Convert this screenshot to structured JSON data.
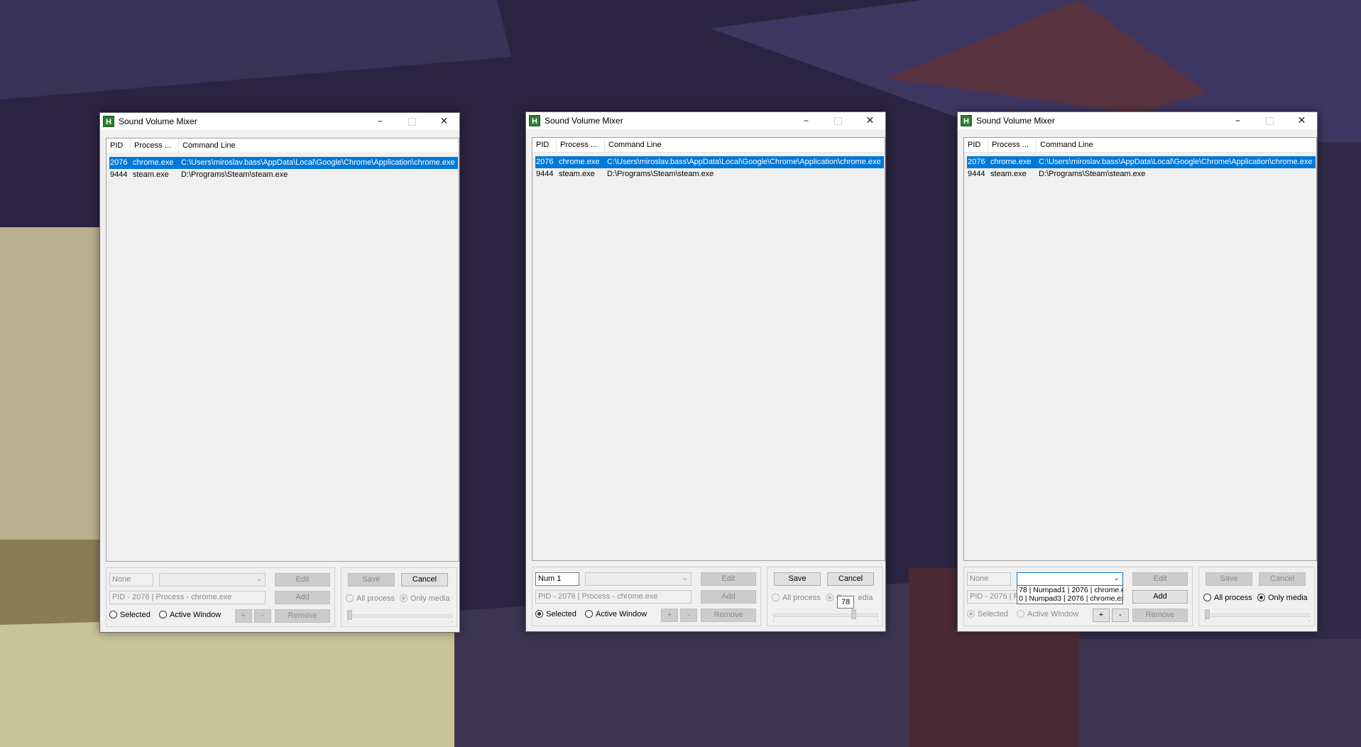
{
  "windows": [
    {
      "title": "Sound Volume Mixer",
      "controls": {
        "minimize": "–",
        "maximize": "□",
        "close": "✕"
      },
      "columns": [
        "PID",
        "Process ...",
        "Command Line"
      ],
      "rows": [
        {
          "pid": "2076",
          "process": "chrome.exe",
          "cmd": "C:\\Users\\miroslav.bass\\AppData\\Local\\Google\\Chrome\\Application\\chrome.exe",
          "selected": true
        },
        {
          "pid": "9444",
          "process": "steam.exe",
          "cmd": "D:\\Programs\\Steam\\steam.exe",
          "selected": false
        }
      ],
      "hotkey_input": "None",
      "info_text": "PID - 2076 | Process - chrome.exe",
      "edit": "Edit",
      "add": "Add",
      "remove": "Remove",
      "selected_label": "Selected",
      "active_window_label": "Active Window",
      "plus": "+",
      "minus": "-",
      "save": "Save",
      "cancel": "Cancel",
      "all_process": "All process",
      "only_media": "Only media"
    },
    {
      "title": "Sound Volume Mixer",
      "controls": {
        "minimize": "–",
        "maximize": "□",
        "close": "✕"
      },
      "columns": [
        "PID",
        "Process ...",
        "Command Line"
      ],
      "rows": [
        {
          "pid": "2076",
          "process": "chrome.exe",
          "cmd": "C:\\Users\\miroslav.bass\\AppData\\Local\\Google\\Chrome\\Application\\chrome.exe",
          "selected": true
        },
        {
          "pid": "9444",
          "process": "steam.exe",
          "cmd": "D:\\Programs\\Steam\\steam.exe",
          "selected": false
        }
      ],
      "hotkey_input": "Num 1",
      "info_text": "PID - 2076 | Process - chrome.exe",
      "edit": "Edit",
      "add": "Add",
      "remove": "Remove",
      "selected_label": "Selected",
      "active_window_label": "Active Window",
      "plus": "+",
      "minus": "-",
      "save": "Save",
      "cancel": "Cancel",
      "all_process": "All process",
      "only_media": "Only media",
      "only_media_visible": "O",
      "only_media_tail": "edia",
      "volume_tooltip": "78",
      "volume_value": 78
    },
    {
      "title": "Sound Volume Mixer",
      "controls": {
        "minimize": "–",
        "maximize": "□",
        "close": "✕"
      },
      "columns": [
        "PID",
        "Process ...",
        "Command Line"
      ],
      "rows": [
        {
          "pid": "2076",
          "process": "chrome.exe",
          "cmd": "C:\\Users\\miroslav.bass\\AppData\\Local\\Google\\Chrome\\Application\\chrome.exe",
          "selected": true
        },
        {
          "pid": "9444",
          "process": "steam.exe",
          "cmd": "D:\\Programs\\Steam\\steam.exe",
          "selected": false
        }
      ],
      "hotkey_input": "None",
      "info_text": "PID - 2076 | P",
      "dropdown_options": [
        "78 | Numpad1 | 2076 | chrome.e",
        "0 | Numpad3 | 2076 | chrome.ex"
      ],
      "edit": "Edit",
      "add": "Add",
      "remove": "Remove",
      "selected_label": "Selected",
      "active_window_label": "Active Window",
      "plus": "+",
      "minus": "-",
      "save": "Save",
      "cancel": "Cancel",
      "all_process": "All process",
      "only_media": "Only media"
    }
  ],
  "colors": {
    "selection": "#0078d7",
    "window_bg": "#f0f0f0"
  }
}
